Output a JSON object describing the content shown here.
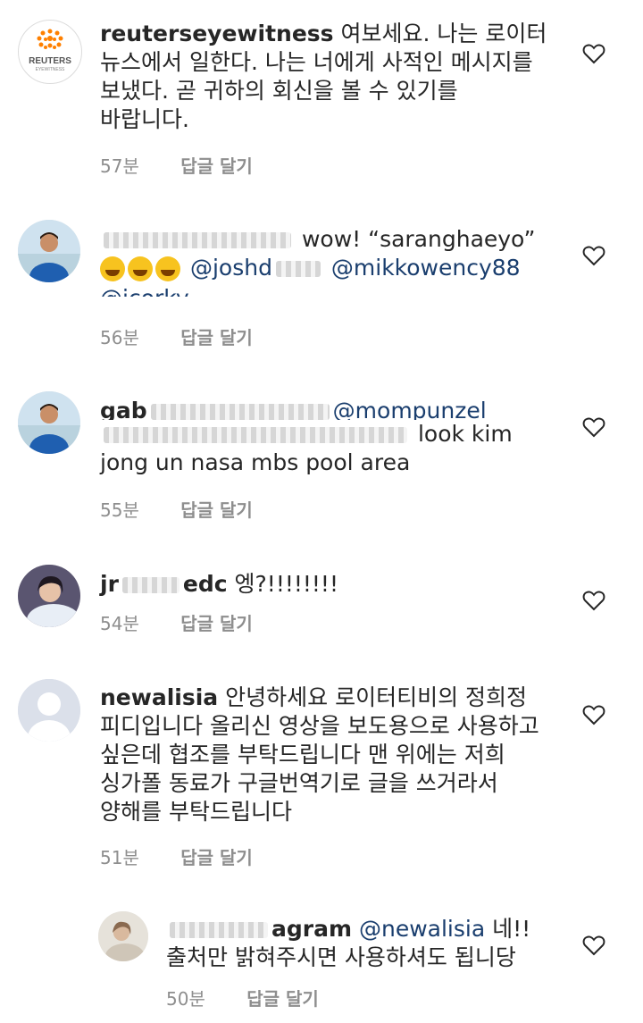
{
  "comments": [
    {
      "username": "reuterseyewitness",
      "text": "여보세요. 나는 로이터",
      "lines": [
        "뉴스에서 일한다. 나는 너에게 사적인 메시지를",
        "보냈다. 곧 귀하의 회신을 볼 수 있기를",
        "바랍니다."
      ],
      "time": "57분",
      "reply": "답글 달기",
      "avatar_logo_text": "REUTERS",
      "avatar_logo_sub": "EYEWITNESS"
    },
    {
      "text": "wow! “saranghaeyo”",
      "mention1": "@joshd",
      "mention2": "@mikkowency88",
      "mention3": "@jcorky",
      "time": "56분",
      "reply": "답글 달기"
    },
    {
      "username_partial": "gab",
      "mention1": "@mompunzel",
      "text": "look kim",
      "line2": "jong un nasa mbs pool area",
      "time": "55분",
      "reply": "답글 달기"
    },
    {
      "username_start": "jr",
      "username_end": "edc",
      "text": "엥?!!!!!!!!",
      "time": "54분",
      "reply": "답글 달기"
    },
    {
      "username": "newalisia",
      "text": "안녕하세요 로이터티비의 정희정",
      "lines": [
        "피디입니다 올리신 영상을 보도용으로 사용하고",
        "싶은데 협조를 부탁드립니다 맨 위에는 저희",
        "싱가폴 동료가 구글번역기로 글을 쓰거라서",
        "양해를 부탁드립니다"
      ],
      "time": "51분",
      "reply": "답글 달기"
    },
    {
      "username_end": "agram",
      "mention": "@newalisia",
      "text": "네!!",
      "line2": "출처만 밝혀주시면 사용하셔도 됩니당",
      "time": "50분",
      "reply": "답글 달기"
    }
  ],
  "colors": {
    "text": "#262626",
    "meta": "#8e8e8e",
    "mention": "#1a3e6e",
    "reuters_orange": "#ff8000"
  },
  "icons": {
    "like": "heart-outline-icon",
    "default_avatar": "person-silhouette-icon"
  }
}
